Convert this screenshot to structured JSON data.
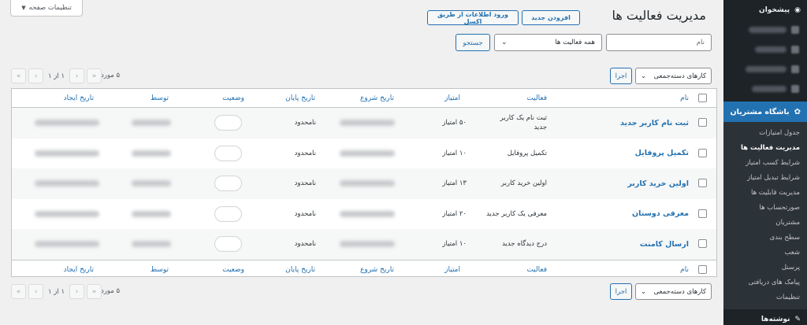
{
  "screen_options": {
    "label": "تنظیمات صفحه"
  },
  "header": {
    "title": "مدیریت فعالیت ها",
    "add_new": "افزودن جدید",
    "import_excel": "ورود اطلاعات از طریق اکسل"
  },
  "filters": {
    "name_placeholder": "نام",
    "activity_select": "همه فعالیت ها",
    "search_button": "جستجو"
  },
  "table_nav": {
    "bulk_actions": "کارهای دسته‌جمعی",
    "apply": "اجرا",
    "items_count": "۵ مورد",
    "page_of": "۱ از ۱",
    "first": "«",
    "prev": "‹",
    "next": "›",
    "last": "»"
  },
  "columns": {
    "name": "نام",
    "activity": "فعالیت",
    "points": "امتیاز",
    "start_date": "تاریخ شروع",
    "end_date": "تاریخ پایان",
    "status": "وضعیت",
    "by": "توسط",
    "created": "تاریخ ایجاد"
  },
  "rows": [
    {
      "name": "ثبت نام کاربر جدید",
      "activity": "ثبت نام یک کاربر جدید",
      "points": "۵۰ امتیاز",
      "end_date": "نامحدود"
    },
    {
      "name": "تکمیل پروفایل",
      "activity": "تکمیل پروفایل",
      "points": "۱۰ امتیاز",
      "end_date": "نامحدود"
    },
    {
      "name": "اولین خرید کاربر",
      "activity": "اولین خرید کاربر",
      "points": "۱۳ امتیاز",
      "end_date": "نامحدود"
    },
    {
      "name": "معرفی دوستان",
      "activity": "معرفی یک کاربر جدید",
      "points": "۲۰ امتیاز",
      "end_date": "نامحدود"
    },
    {
      "name": "ارسال کامنت",
      "activity": "درج دیدگاه جدید",
      "points": "۱۰ امتیاز",
      "end_date": "نامحدود"
    }
  ],
  "sidebar": {
    "top_item": "پیشخوان",
    "active_menu": "باشگاه مشتریان",
    "submenu": [
      "جدول امتیازات",
      "مدیریت فعالیت ها",
      "شرایط کسب امتیاز",
      "شرایط تبدیل امتیاز",
      "مدیریت قابلیت ها",
      "صورتحساب ها",
      "مشتریان",
      "سطح بندی",
      "شعب",
      "پرسنل",
      "پیامک های دریافتی",
      "تنظیمات"
    ],
    "bottom_item": "نوشته‌ها"
  }
}
